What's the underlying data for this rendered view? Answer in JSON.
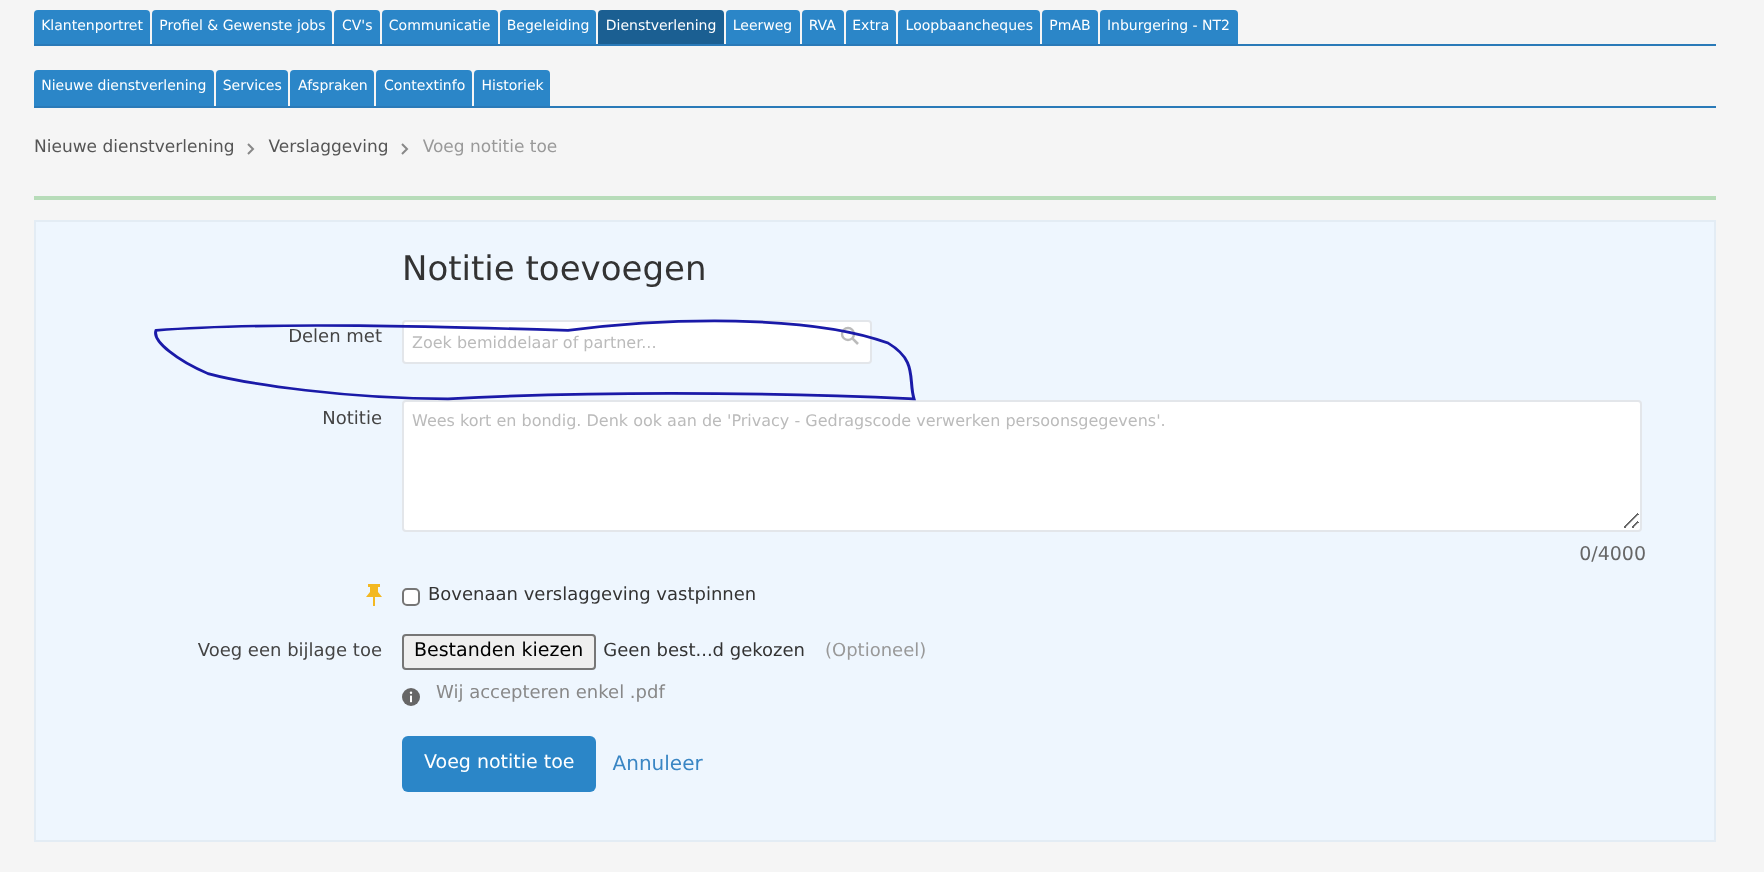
{
  "main_tabs": [
    {
      "label": "Klantenportret",
      "selected": false
    },
    {
      "label": "Profiel & Gewenste jobs",
      "selected": false
    },
    {
      "label": "CV's",
      "selected": false
    },
    {
      "label": "Communicatie",
      "selected": false
    },
    {
      "label": "Begeleiding",
      "selected": false
    },
    {
      "label": "Dienstverlening",
      "selected": true
    },
    {
      "label": "Leerweg",
      "selected": false
    },
    {
      "label": "RVA",
      "selected": false
    },
    {
      "label": "Extra",
      "selected": false
    },
    {
      "label": "Loopbaancheques",
      "selected": false
    },
    {
      "label": "PmAB",
      "selected": false
    },
    {
      "label": "Inburgering - NT2",
      "selected": false
    }
  ],
  "sub_tabs": [
    {
      "label": "Nieuwe dienstverlening"
    },
    {
      "label": "Services"
    },
    {
      "label": "Afspraken"
    },
    {
      "label": "Contextinfo"
    },
    {
      "label": "Historiek"
    }
  ],
  "breadcrumb": [
    "Nieuwe dienstverlening",
    "Verslaggeving",
    "Voeg notitie toe"
  ],
  "form": {
    "title": "Notitie toevoegen",
    "share_field": {
      "label": "Delen met",
      "placeholder": "Zoek bemiddelaar of partner..."
    },
    "note_field": {
      "label": "Notitie",
      "placeholder": "Wees kort en bondig. Denk ook aan de 'Privacy - Gedragscode verwerken persoonsgegevens'.",
      "counter": "0/4000"
    },
    "pin": {
      "label": "Bovenaan verslaggeving vastpinnen",
      "checked": false
    },
    "attachment": {
      "label": "Voeg een bijlage toe",
      "button": "Bestanden kiezen",
      "file_status": "Geen best...d gekozen",
      "optional": "(Optioneel)",
      "hint": "Wij accepteren enkel .pdf"
    },
    "submit": "Voeg notitie toe",
    "cancel": "Annuleer"
  }
}
